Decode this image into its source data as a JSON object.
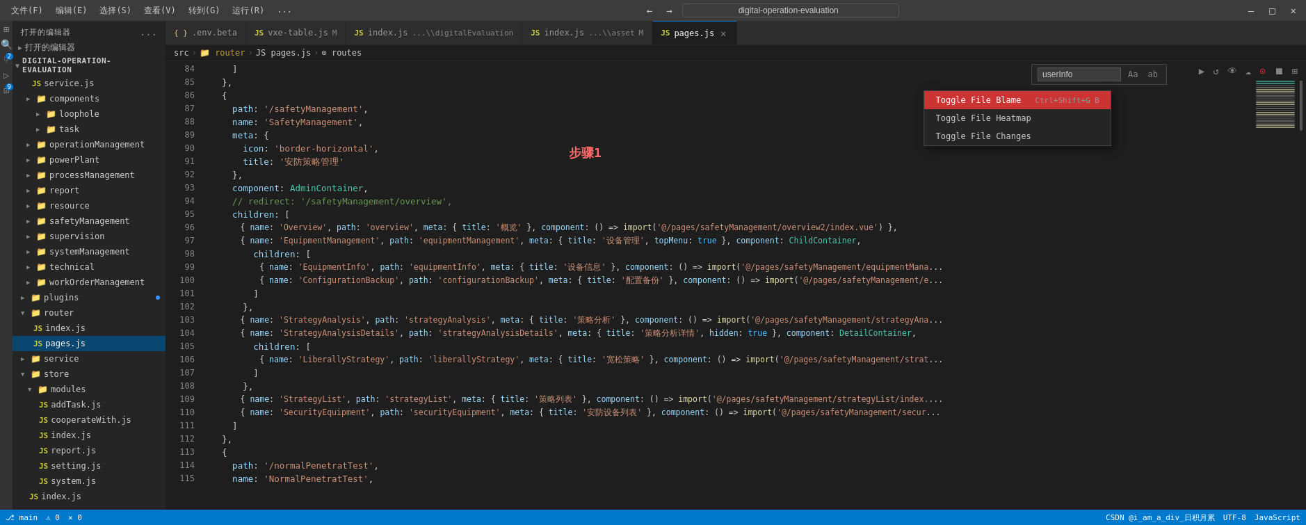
{
  "titlebar": {
    "menu_items": [
      "文件(F)",
      "编辑(E)",
      "选择(S)",
      "查看(V)",
      "转到(G)",
      "运行(R)",
      "..."
    ],
    "search_placeholder": "digital-operation-evaluation",
    "nav_back": "←",
    "nav_forward": "→",
    "window_controls": [
      "—",
      "□",
      "✕"
    ]
  },
  "tabs": [
    {
      "id": "env-beta",
      "label": ".env.beta",
      "icon": "env",
      "active": false,
      "modified": false,
      "closeable": false
    },
    {
      "id": "vxe-table",
      "label": "vxe-table.js",
      "icon": "js",
      "active": false,
      "modified": true,
      "closeable": false
    },
    {
      "id": "index-digital",
      "label": "index.js",
      "sublabel": "...\\digitalEvaluation",
      "icon": "js",
      "active": false,
      "modified": false,
      "closeable": false
    },
    {
      "id": "index-asset",
      "label": "index.js",
      "sublabel": "...\\asset",
      "icon": "js",
      "active": false,
      "modified": true,
      "closeable": false
    },
    {
      "id": "pages",
      "label": "pages.js",
      "icon": "js",
      "active": true,
      "modified": false,
      "closeable": true
    }
  ],
  "breadcrumb": {
    "items": [
      "src",
      "router",
      "pages.js",
      "routes"
    ]
  },
  "sidebar": {
    "open_editors_label": "打开的编辑器",
    "explorer_label": "打开的编辑器",
    "dots_label": "...",
    "root": "DIGITAL-OPERATION-EVALUATION",
    "tree": [
      {
        "level": 1,
        "type": "folder",
        "label": "service.js",
        "icon": "js",
        "expanded": false
      },
      {
        "level": 1,
        "type": "folder",
        "label": "components",
        "icon": "folder",
        "expanded": false
      },
      {
        "level": 2,
        "type": "folder",
        "label": "loophole",
        "icon": "folder",
        "expanded": false
      },
      {
        "level": 2,
        "type": "file",
        "label": "task",
        "icon": "folder",
        "expanded": false
      },
      {
        "level": 1,
        "type": "folder",
        "label": "operationManagement",
        "icon": "folder",
        "expanded": false
      },
      {
        "level": 1,
        "type": "folder",
        "label": "powerPlant",
        "icon": "folder",
        "expanded": false
      },
      {
        "level": 1,
        "type": "folder",
        "label": "processManagement",
        "icon": "folder",
        "expanded": false
      },
      {
        "level": 1,
        "type": "folder",
        "label": "report",
        "icon": "folder",
        "expanded": false
      },
      {
        "level": 1,
        "type": "folder",
        "label": "resource",
        "icon": "folder",
        "expanded": false
      },
      {
        "level": 1,
        "type": "folder",
        "label": "safetyManagement",
        "icon": "folder",
        "expanded": false
      },
      {
        "level": 1,
        "type": "folder",
        "label": "supervision",
        "icon": "folder",
        "expanded": false
      },
      {
        "level": 1,
        "type": "folder",
        "label": "systemManagement",
        "icon": "folder",
        "expanded": false
      },
      {
        "level": 1,
        "type": "folder",
        "label": "technical",
        "icon": "folder",
        "expanded": false
      },
      {
        "level": 1,
        "type": "folder",
        "label": "workOrderManagement",
        "icon": "folder",
        "expanded": false
      },
      {
        "level": 0,
        "type": "folder",
        "label": "plugins",
        "icon": "folder",
        "expanded": false,
        "dot": true
      },
      {
        "level": 0,
        "type": "folder",
        "label": "router",
        "icon": "folder",
        "expanded": true
      },
      {
        "level": 1,
        "type": "file",
        "label": "index.js",
        "icon": "js",
        "expanded": false
      },
      {
        "level": 1,
        "type": "file",
        "label": "pages.js",
        "icon": "js",
        "expanded": false,
        "active": true
      },
      {
        "level": 0,
        "type": "folder",
        "label": "service",
        "icon": "folder",
        "expanded": false
      },
      {
        "level": 0,
        "type": "folder",
        "label": "store",
        "icon": "folder",
        "expanded": true
      },
      {
        "level": 1,
        "type": "folder",
        "label": "modules",
        "icon": "folder",
        "expanded": true
      },
      {
        "level": 2,
        "type": "file",
        "label": "addTask.js",
        "icon": "js",
        "expanded": false
      },
      {
        "level": 2,
        "type": "file",
        "label": "cooperateWith.js",
        "icon": "js",
        "expanded": false
      },
      {
        "level": 2,
        "type": "file",
        "label": "index.js",
        "icon": "js",
        "expanded": false
      },
      {
        "level": 2,
        "type": "file",
        "label": "report.js",
        "icon": "js",
        "expanded": false
      },
      {
        "level": 2,
        "type": "file",
        "label": "setting.js",
        "icon": "js",
        "expanded": false
      },
      {
        "level": 2,
        "type": "file",
        "label": "system.js",
        "icon": "js",
        "expanded": false
      },
      {
        "level": 1,
        "type": "file",
        "label": "index.js",
        "icon": "js",
        "expanded": false
      }
    ]
  },
  "code": {
    "lines": [
      {
        "num": 84,
        "text": "    ]"
      },
      {
        "num": 85,
        "text": "  },"
      },
      {
        "num": 86,
        "text": "  {"
      },
      {
        "num": 87,
        "text": "    path: '/safetyManagement',"
      },
      {
        "num": 88,
        "text": "    name: 'SafetyManagement',"
      },
      {
        "num": 89,
        "text": "    meta: {"
      },
      {
        "num": 90,
        "text": "      icon: 'border-horizontal',"
      },
      {
        "num": 91,
        "text": "      title: '安防策略管理'"
      },
      {
        "num": 92,
        "text": "    },"
      },
      {
        "num": 93,
        "text": "    component: AdminContainer,"
      },
      {
        "num": 94,
        "text": "    // redirect: '/safetyManagement/overview',"
      },
      {
        "num": 95,
        "text": "    children: ["
      },
      {
        "num": 96,
        "text": "      { name: 'Overview', path: 'overview', meta: { title: '概览' }, component: () => import('@/pages/safetyManagement/overview2/index.vue') },"
      },
      {
        "num": 97,
        "text": "      { name: 'EquipmentManagement', path: 'equipmentManagement', meta: { title: '设备管理', topMenu: true }, component: ChildContainer,"
      },
      {
        "num": 98,
        "text": "        children: ["
      },
      {
        "num": 99,
        "text": "          { name: 'EquipmentInfo', path: 'equipmentInfo', meta: { title: '设备信息' }, component: () => import('@/pages/safetyManagement/equipmentMana"
      },
      {
        "num": 100,
        "text": "          { name: 'ConfigurationBackup', path: 'configurationBackup', meta: { title: '配置备份' }, component: () => import('@/pages/safetyManagement/e"
      },
      {
        "num": 101,
        "text": "        ]"
      },
      {
        "num": 102,
        "text": "      },"
      },
      {
        "num": 103,
        "text": "      { name: 'StrategyAnalysis', path: 'strategyAnalysis', meta: { title: '策略分析' }, component: () => import('@/pages/safetyManagement/strategyAna"
      },
      {
        "num": 104,
        "text": "      { name: 'StrategyAnalysisDetails', path: 'strategyAnalysisDetails', meta: { title: '策略分析详情', hidden: true }, component: DetailContainer,"
      },
      {
        "num": 105,
        "text": "        children: ["
      },
      {
        "num": 106,
        "text": "          { name: 'LiberallyStrategy', path: 'liberallyStrategy', meta: { title: '宽松策略' }, component: () => import('@/pages/safetyManagement/strat"
      },
      {
        "num": 107,
        "text": "        ]"
      },
      {
        "num": 108,
        "text": "      },"
      },
      {
        "num": 109,
        "text": "      { name: 'StrategyList', path: 'strategyList', meta: { title: '策略列表' }, component: () => import('@/pages/safetyManagement/strategyList/index."
      },
      {
        "num": 110,
        "text": "      { name: 'SecurityEquipment', path: 'securityEquipment', meta: { title: '安防设备列表' }, component: () => import('@/pages/safetyManagement/secur"
      },
      {
        "num": 111,
        "text": "    ]"
      },
      {
        "num": 112,
        "text": "  },"
      },
      {
        "num": 113,
        "text": "  {"
      },
      {
        "num": 114,
        "text": "    path: '/normalPenetratTest',"
      },
      {
        "num": 115,
        "text": "    name: 'NormalPenetratTest',"
      }
    ]
  },
  "context_menu": {
    "items": [
      {
        "label": "Toggle File Blame",
        "shortcut": "Ctrl+Shift+G B",
        "highlighted": true
      },
      {
        "label": "Toggle File Heatmap",
        "shortcut": ""
      },
      {
        "label": "Toggle File Changes",
        "shortcut": ""
      }
    ]
  },
  "find_widget": {
    "value": "userInfo",
    "btn_aa": "Aa",
    "btn_ab": "ab"
  },
  "step_annotation": "步骤1",
  "status_bar": {
    "left": [
      "⎇ main",
      "⚠ 0",
      "✕ 0"
    ],
    "right": [
      "CSDN @i_am_a_div_日积月累",
      "UTF-8",
      "JavaScript"
    ]
  },
  "editor_toolbar_btns": [
    "▶",
    "↺",
    "👁",
    "☁",
    "⊙",
    "⏹",
    "⊞"
  ]
}
